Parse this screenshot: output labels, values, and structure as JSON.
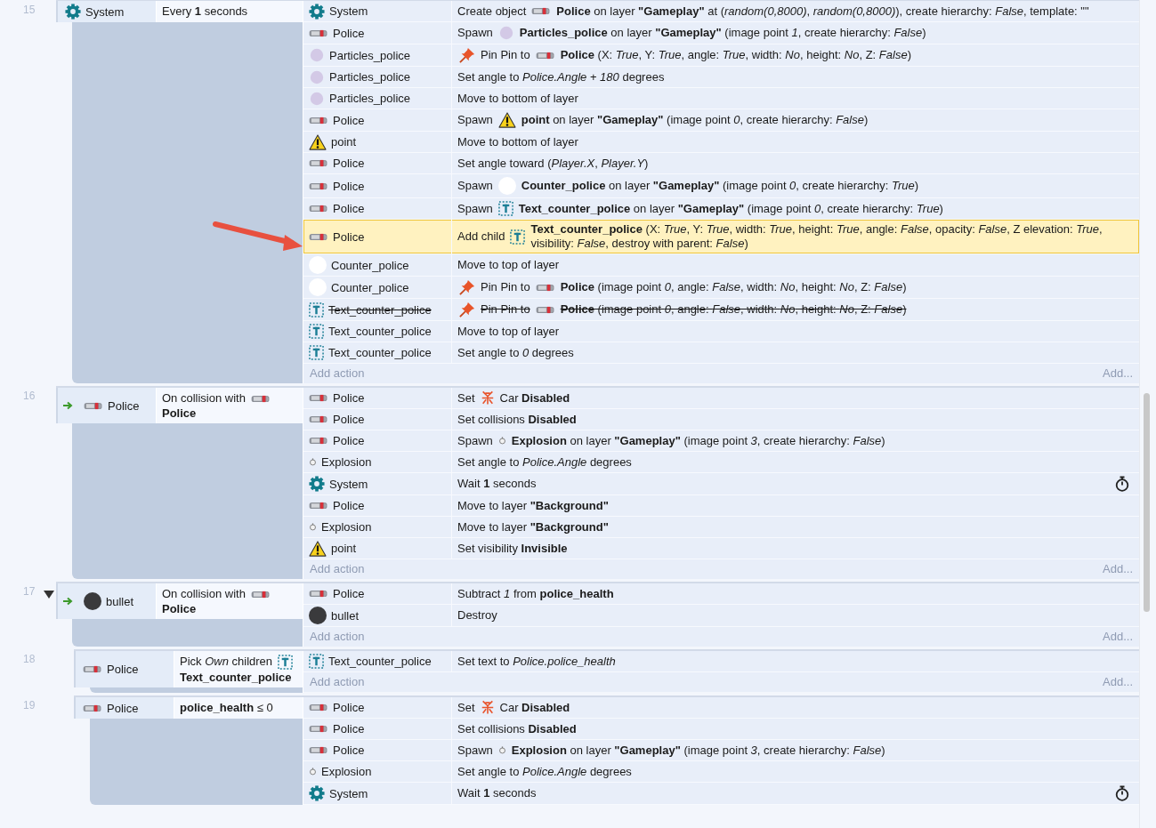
{
  "events": [
    {
      "number": "15",
      "trigger": false,
      "condition": {
        "object": "System",
        "kind": "system",
        "parts": [
          {
            "text": "Every **1** seconds"
          }
        ]
      },
      "actions": [
        {
          "object": "System",
          "kind": "system",
          "selected": false,
          "disabled": false,
          "parts": [
            {
              "text": "Create object"
            },
            {
              "kind": "car"
            },
            {
              "text": "**Police** on layer **\"Gameplay\"** at (*random(0,8000)*, *random(0,8000)*), create hierarchy: *False*, template: \"\""
            }
          ]
        },
        {
          "object": "Police",
          "kind": "car",
          "selected": false,
          "disabled": false,
          "parts": [
            {
              "text": "Spawn"
            },
            {
              "kind": "particles"
            },
            {
              "text": "**Particles_police** on layer **\"Gameplay\"** (image point *1*, create hierarchy: *False*)"
            }
          ]
        },
        {
          "object": "Particles_police",
          "kind": "particles",
          "selected": false,
          "disabled": false,
          "parts": [
            {
              "kind": "pin"
            },
            {
              "text": "Pin Pin to"
            },
            {
              "kind": "car"
            },
            {
              "text": "**Police** (X: *True*, Y: *True*, angle: *True*, width: *No*, height: *No*, Z: *False*)"
            }
          ]
        },
        {
          "object": "Particles_police",
          "kind": "particles",
          "selected": false,
          "disabled": false,
          "parts": [
            {
              "text": "Set angle to *Police.Angle* + *180* degrees"
            }
          ]
        },
        {
          "object": "Particles_police",
          "kind": "particles",
          "selected": false,
          "disabled": false,
          "parts": [
            {
              "text": "Move to bottom of layer"
            }
          ]
        },
        {
          "object": "Police",
          "kind": "car",
          "selected": false,
          "disabled": false,
          "parts": [
            {
              "text": "Spawn"
            },
            {
              "kind": "warning"
            },
            {
              "text": "**point** on layer **\"Gameplay\"** (image point *0*, create hierarchy: *False*)"
            }
          ]
        },
        {
          "object": "point",
          "kind": "warning",
          "selected": false,
          "disabled": false,
          "parts": [
            {
              "text": "Move to bottom of layer"
            }
          ]
        },
        {
          "object": "Police",
          "kind": "car",
          "selected": false,
          "disabled": false,
          "parts": [
            {
              "text": "Set angle toward (*Player.X*, *Player.Y*)"
            }
          ]
        },
        {
          "object": "Police",
          "kind": "car",
          "selected": false,
          "disabled": false,
          "parts": [
            {
              "text": "Spawn"
            },
            {
              "kind": "circle"
            },
            {
              "text": "**Counter_police** on layer **\"Gameplay\"** (image point *0*, create hierarchy: *True*)"
            }
          ]
        },
        {
          "object": "Police",
          "kind": "car",
          "selected": false,
          "disabled": false,
          "parts": [
            {
              "text": "Spawn"
            },
            {
              "kind": "text"
            },
            {
              "text": "**Text_counter_police** on layer **\"Gameplay\"** (image point *0*, create hierarchy: *True*)"
            }
          ]
        },
        {
          "object": "Police",
          "kind": "car",
          "selected": true,
          "disabled": false,
          "parts": [
            {
              "text": "Add child"
            },
            {
              "kind": "text"
            },
            {
              "text": "**Text_counter_police** (X: *True*, Y: *True*, width: *True*, height: *True*, angle: *False*, opacity: *False*, Z elevation: *True*, visibility: *False*, destroy with parent: *False*)"
            }
          ]
        },
        {
          "object": "Counter_police",
          "kind": "circle",
          "selected": false,
          "disabled": false,
          "parts": [
            {
              "text": "Move to top of layer"
            }
          ]
        },
        {
          "object": "Counter_police",
          "kind": "circle",
          "selected": false,
          "disabled": false,
          "parts": [
            {
              "kind": "pin"
            },
            {
              "text": "Pin Pin to"
            },
            {
              "kind": "car"
            },
            {
              "text": "**Police** (image point *0*, angle: *False*, width: *No*, height: *No*, Z: *False*)"
            }
          ]
        },
        {
          "object": "Text_counter_police",
          "kind": "text",
          "selected": false,
          "disabled": true,
          "parts": [
            {
              "kind": "pin"
            },
            {
              "text": "Pin Pin to"
            },
            {
              "kind": "car"
            },
            {
              "text": "**Police** (image point *0*, angle: *False*, width: *No*, height: *No*, Z: *False*)"
            }
          ]
        },
        {
          "object": "Text_counter_police",
          "kind": "text",
          "selected": false,
          "disabled": false,
          "parts": [
            {
              "text": "Move to top of layer"
            }
          ]
        },
        {
          "object": "Text_counter_police",
          "kind": "text",
          "selected": false,
          "disabled": false,
          "parts": [
            {
              "text": "Set angle to *0* degrees"
            }
          ]
        }
      ],
      "add_action": "Add action",
      "add_more": "Add..."
    },
    {
      "number": "16",
      "trigger": true,
      "condition": {
        "object": "Police",
        "kind": "car",
        "parts": [
          {
            "text": "On collision with"
          },
          {
            "kind": "car"
          },
          {
            "text": "**Police**"
          }
        ]
      },
      "actions": [
        {
          "object": "Police",
          "kind": "car",
          "selected": false,
          "disabled": false,
          "parts": [
            {
              "text": "Set"
            },
            {
              "kind": "spark"
            },
            {
              "text": "Car **Disabled**"
            }
          ]
        },
        {
          "object": "Police",
          "kind": "car",
          "selected": false,
          "disabled": false,
          "parts": [
            {
              "text": "Set collisions **Disabled**"
            }
          ]
        },
        {
          "object": "Police",
          "kind": "car",
          "selected": false,
          "disabled": false,
          "parts": [
            {
              "text": "Spawn"
            },
            {
              "kind": "explosion"
            },
            {
              "text": "**Explosion** on layer **\"Gameplay\"** (image point *3*, create hierarchy: *False*)"
            }
          ]
        },
        {
          "object": "Explosion",
          "kind": "explosion",
          "selected": false,
          "disabled": false,
          "parts": [
            {
              "text": "Set angle to *Police.Angle* degrees"
            }
          ]
        },
        {
          "object": "System",
          "kind": "system",
          "selected": false,
          "disabled": false,
          "timer": true,
          "parts": [
            {
              "text": "Wait **1** seconds"
            }
          ]
        },
        {
          "object": "Police",
          "kind": "car",
          "selected": false,
          "disabled": false,
          "parts": [
            {
              "text": "Move to layer **\"Background\"**"
            }
          ]
        },
        {
          "object": "Explosion",
          "kind": "explosion",
          "selected": false,
          "disabled": false,
          "parts": [
            {
              "text": "Move to layer **\"Background\"**"
            }
          ]
        },
        {
          "object": "point",
          "kind": "warning",
          "selected": false,
          "disabled": false,
          "parts": [
            {
              "text": "Set visibility **Invisible**"
            }
          ]
        }
      ],
      "add_action": "Add action",
      "add_more": "Add..."
    },
    {
      "number": "17",
      "trigger": true,
      "expanded": true,
      "condition": {
        "object": "bullet",
        "kind": "bullet",
        "parts": [
          {
            "text": "On collision with"
          },
          {
            "kind": "car"
          },
          {
            "text": "**Police**"
          }
        ]
      },
      "actions": [
        {
          "object": "Police",
          "kind": "car",
          "selected": false,
          "disabled": false,
          "parts": [
            {
              "text": "Subtract *1* from **police_health**"
            }
          ]
        },
        {
          "object": "bullet",
          "kind": "bullet",
          "selected": false,
          "disabled": false,
          "parts": [
            {
              "text": "Destroy"
            }
          ]
        }
      ],
      "add_action": "Add action",
      "add_more": "Add...",
      "children": [
        {
          "number": "18",
          "trigger": false,
          "condition": {
            "object": "Police",
            "kind": "car",
            "parts": [
              {
                "text": "Pick *Own* children"
              },
              {
                "kind": "text"
              },
              {
                "text": "**Text_counter_police**"
              }
            ]
          },
          "actions": [
            {
              "object": "Text_counter_police",
              "kind": "text",
              "selected": false,
              "disabled": false,
              "parts": [
                {
                  "text": "Set text to *Police.police_health*"
                }
              ]
            }
          ],
          "add_action": "Add action",
          "add_more": "Add..."
        },
        {
          "number": "19",
          "trigger": false,
          "condition": {
            "object": "Police",
            "kind": "car",
            "parts": [
              {
                "text": "**police_health** ≤ 0"
              }
            ]
          },
          "actions": [
            {
              "object": "Police",
              "kind": "car",
              "selected": false,
              "disabled": false,
              "parts": [
                {
                  "text": "Set"
                },
                {
                  "kind": "spark"
                },
                {
                  "text": "Car **Disabled**"
                }
              ]
            },
            {
              "object": "Police",
              "kind": "car",
              "selected": false,
              "disabled": false,
              "parts": [
                {
                  "text": "Set collisions **Disabled**"
                }
              ]
            },
            {
              "object": "Police",
              "kind": "car",
              "selected": false,
              "disabled": false,
              "parts": [
                {
                  "text": "Spawn"
                },
                {
                  "kind": "explosion"
                },
                {
                  "text": "**Explosion** on layer **\"Gameplay\"** (image point *3*, create hierarchy: *False*)"
                }
              ]
            },
            {
              "object": "Explosion",
              "kind": "explosion",
              "selected": false,
              "disabled": false,
              "parts": [
                {
                  "text": "Set angle to *Police.Angle* degrees"
                }
              ]
            },
            {
              "object": "System",
              "kind": "system",
              "selected": false,
              "disabled": false,
              "timer": true,
              "parts": [
                {
                  "text": "Wait **1** seconds"
                }
              ]
            }
          ]
        }
      ]
    }
  ]
}
